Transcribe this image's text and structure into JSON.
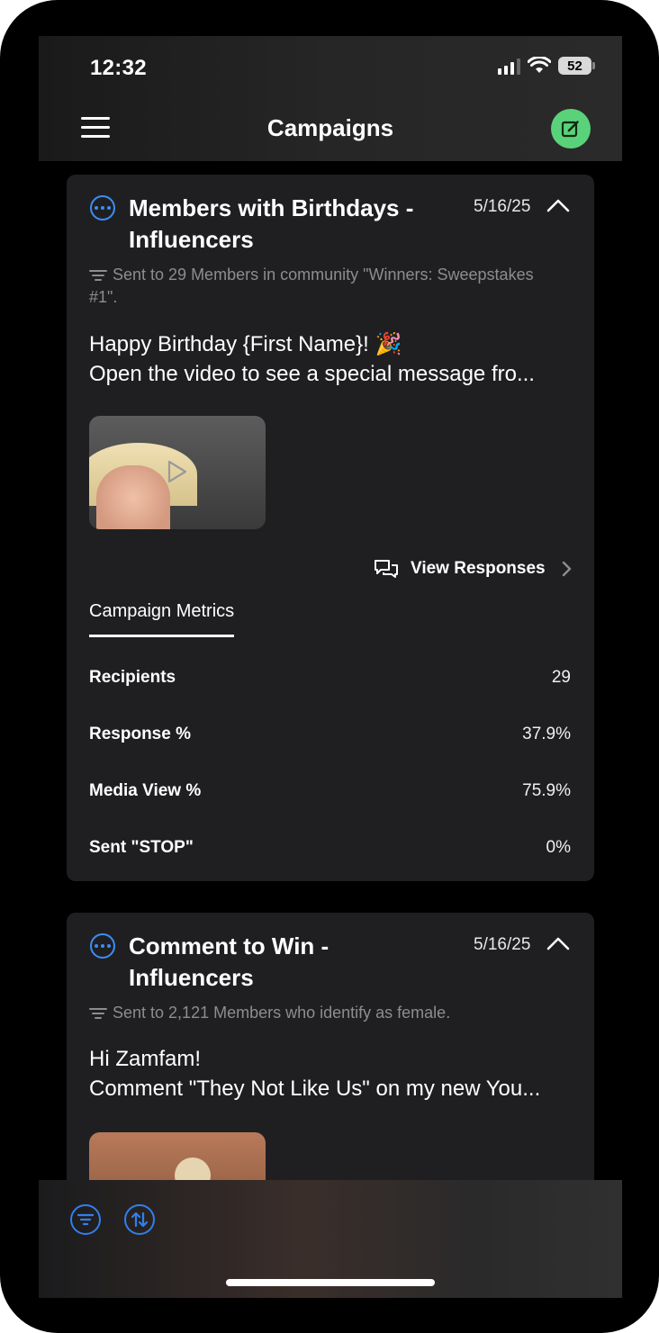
{
  "status_bar": {
    "time": "12:32",
    "battery": "52"
  },
  "header": {
    "title": "Campaigns"
  },
  "campaigns": [
    {
      "title": "Members with Birthdays - Influencers",
      "date": "5/16/25",
      "sent_to": "Sent to 29 Members in community \"Winners: Sweepstakes #1\".",
      "message_line1": "Happy Birthday {First Name}! 🎉",
      "message_line2": "Open the video to see a special message fro...",
      "view_responses": "View Responses",
      "metrics_tab": "Campaign Metrics",
      "metrics": [
        {
          "label": "Recipients",
          "value": "29"
        },
        {
          "label": "Response %",
          "value": "37.9%"
        },
        {
          "label": "Media View %",
          "value": "75.9%"
        },
        {
          "label": "Sent \"STOP\"",
          "value": "0%"
        }
      ]
    },
    {
      "title": "Comment to Win - Influencers",
      "date": "5/16/25",
      "sent_to": "Sent to 2,121 Members who identify as female.",
      "message_line1": "Hi Zamfam!",
      "message_line2": "Comment \"They Not Like Us\" on my new You..."
    }
  ],
  "colors": {
    "accent_blue": "#3b8ef5",
    "compose_green": "#5ad27a",
    "card_bg": "#1f1f21"
  }
}
